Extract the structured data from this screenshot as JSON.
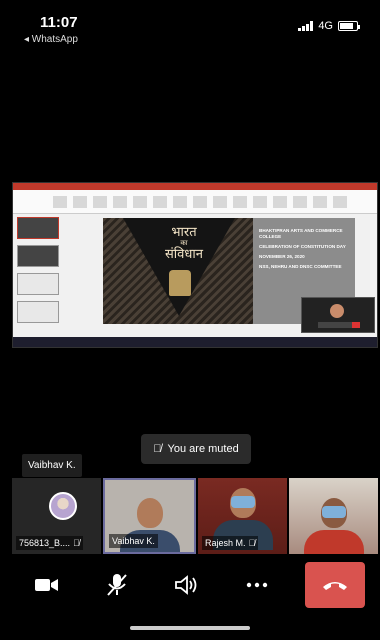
{
  "status_bar": {
    "time": "11:07",
    "back_app": "◂ WhatsApp",
    "network": "4G"
  },
  "slide": {
    "hindi_line1": "भारत",
    "hindi_line2": "का",
    "hindi_line3": "संविधान",
    "college": "BHAKTIPRAN ARTS AND COMMERCE COLLEGE",
    "event": "CELEBRATION OF CONSTITUTION DAY",
    "date": "NOVEMBER 26, 2020",
    "committee": "NSS, NEHRU AND DNSC COMMITTEE"
  },
  "toast": {
    "muted_text": "You are muted",
    "icon": "mic-muted-icon"
  },
  "active_speaker": "Vaibhav K.",
  "participants": [
    {
      "name": "756813_B....",
      "muted": true,
      "type": "avatar"
    },
    {
      "name": "Vaibhav K.",
      "muted": false,
      "type": "video",
      "active": true
    },
    {
      "name": "Rajesh M.",
      "muted": true,
      "type": "video"
    },
    {
      "name": "",
      "muted": false,
      "type": "video"
    }
  ],
  "controls": {
    "camera": "camera-icon",
    "mic": "mic-off-icon",
    "speaker": "speaker-icon",
    "more": "more-icon",
    "end": "end-call-icon"
  },
  "colors": {
    "end_call": "#d9534f",
    "active_border": "#6b6b9e"
  }
}
